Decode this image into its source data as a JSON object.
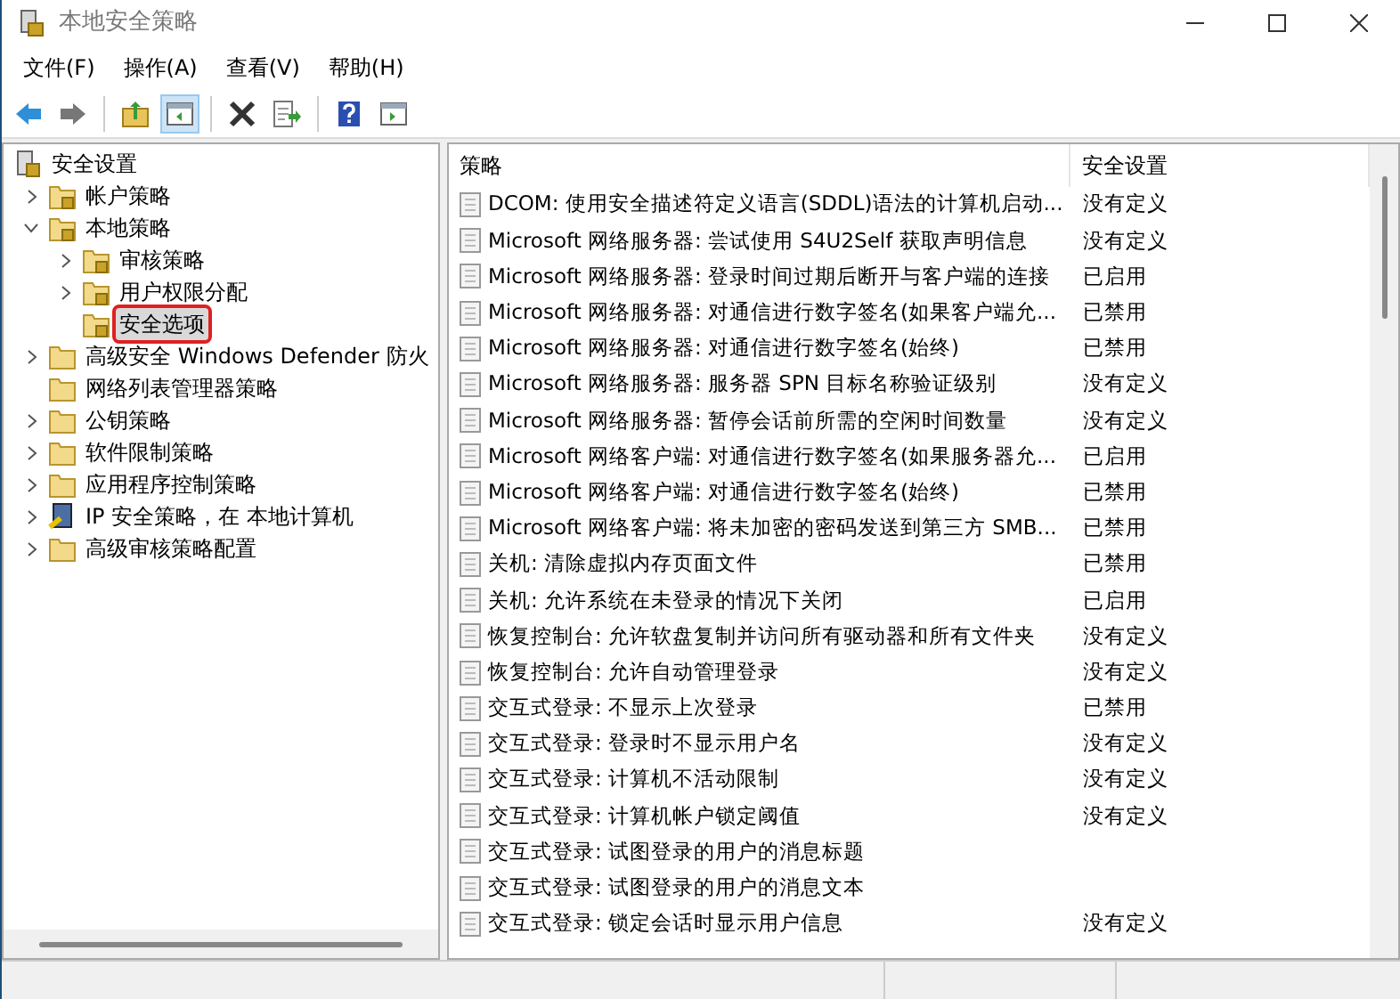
{
  "window": {
    "title": "本地安全策略"
  },
  "menu": [
    "文件(F)",
    "操作(A)",
    "查看(V)",
    "帮助(H)"
  ],
  "toolbar": [
    {
      "kind": "back"
    },
    {
      "kind": "forward"
    },
    {
      "kind": "up"
    },
    {
      "kind": "tree",
      "selected": true
    },
    {
      "kind": "delete"
    },
    {
      "kind": "export"
    },
    {
      "kind": "help"
    },
    {
      "kind": "pane"
    }
  ],
  "tree": [
    {
      "label": "安全设置",
      "kind": "root",
      "selected": false,
      "children": [
        {
          "label": "帐户策略",
          "kind": "lock",
          "expanded": false,
          "selected": false
        },
        {
          "label": "本地策略",
          "kind": "lock",
          "expanded": true,
          "selected": false,
          "children": [
            {
              "label": "审核策略",
              "kind": "lock",
              "expanded": false,
              "selected": false
            },
            {
              "label": "用户权限分配",
              "kind": "lock",
              "expanded": false,
              "selected": false
            },
            {
              "label": "安全选项",
              "kind": "lock",
              "selected": true
            }
          ]
        },
        {
          "label": "高级安全 Windows Defender 防火",
          "kind": "folder",
          "expanded": false,
          "selected": false
        },
        {
          "label": "网络列表管理器策略",
          "kind": "folder",
          "selected": false
        },
        {
          "label": "公钥策略",
          "kind": "folder",
          "expanded": false,
          "selected": false
        },
        {
          "label": "软件限制策略",
          "kind": "folder",
          "expanded": false,
          "selected": false
        },
        {
          "label": "应用程序控制策略",
          "kind": "folder",
          "expanded": false,
          "selected": false
        },
        {
          "label": "IP 安全策略，在 本地计算机",
          "kind": "ip",
          "expanded": false,
          "selected": false
        },
        {
          "label": "高级审核策略配置",
          "kind": "folder",
          "expanded": false,
          "selected": false
        }
      ]
    }
  ],
  "table": {
    "columns": [
      "策略",
      "安全设置"
    ],
    "rows": [
      {
        "policy": "DCOM: 使用安全描述符定义语言(SDDL)语法的计算机启动...",
        "setting": "没有定义"
      },
      {
        "policy": "Microsoft 网络服务器: 尝试使用 S4U2Self 获取声明信息",
        "setting": "没有定义"
      },
      {
        "policy": "Microsoft 网络服务器: 登录时间过期后断开与客户端的连接",
        "setting": "已启用"
      },
      {
        "policy": "Microsoft 网络服务器: 对通信进行数字签名(如果客户端允...",
        "setting": "已禁用"
      },
      {
        "policy": "Microsoft 网络服务器: 对通信进行数字签名(始终)",
        "setting": "已禁用"
      },
      {
        "policy": "Microsoft 网络服务器: 服务器 SPN 目标名称验证级别",
        "setting": "没有定义"
      },
      {
        "policy": "Microsoft 网络服务器: 暂停会话前所需的空闲时间数量",
        "setting": "没有定义"
      },
      {
        "policy": "Microsoft 网络客户端: 对通信进行数字签名(如果服务器允...",
        "setting": "已启用"
      },
      {
        "policy": "Microsoft 网络客户端: 对通信进行数字签名(始终)",
        "setting": "已禁用"
      },
      {
        "policy": "Microsoft 网络客户端: 将未加密的密码发送到第三方 SMB...",
        "setting": "已禁用"
      },
      {
        "policy": "关机: 清除虚拟内存页面文件",
        "setting": "已禁用"
      },
      {
        "policy": "关机: 允许系统在未登录的情况下关闭",
        "setting": "已启用"
      },
      {
        "policy": "恢复控制台: 允许软盘复制并访问所有驱动器和所有文件夹",
        "setting": "没有定义"
      },
      {
        "policy": "恢复控制台: 允许自动管理登录",
        "setting": "没有定义"
      },
      {
        "policy": "交互式登录: 不显示上次登录",
        "setting": "已禁用"
      },
      {
        "policy": "交互式登录: 登录时不显示用户名",
        "setting": "没有定义"
      },
      {
        "policy": "交互式登录: 计算机不活动限制",
        "setting": "没有定义"
      },
      {
        "policy": "交互式登录: 计算机帐户锁定阈值",
        "setting": "没有定义"
      },
      {
        "policy": "交互式登录: 试图登录的用户的消息标题"
      },
      {
        "policy": "交互式登录: 试图登录的用户的消息文本"
      },
      {
        "policy": "交互式登录: 锁定会话时显示用户信息",
        "setting": "没有定义"
      }
    ]
  }
}
